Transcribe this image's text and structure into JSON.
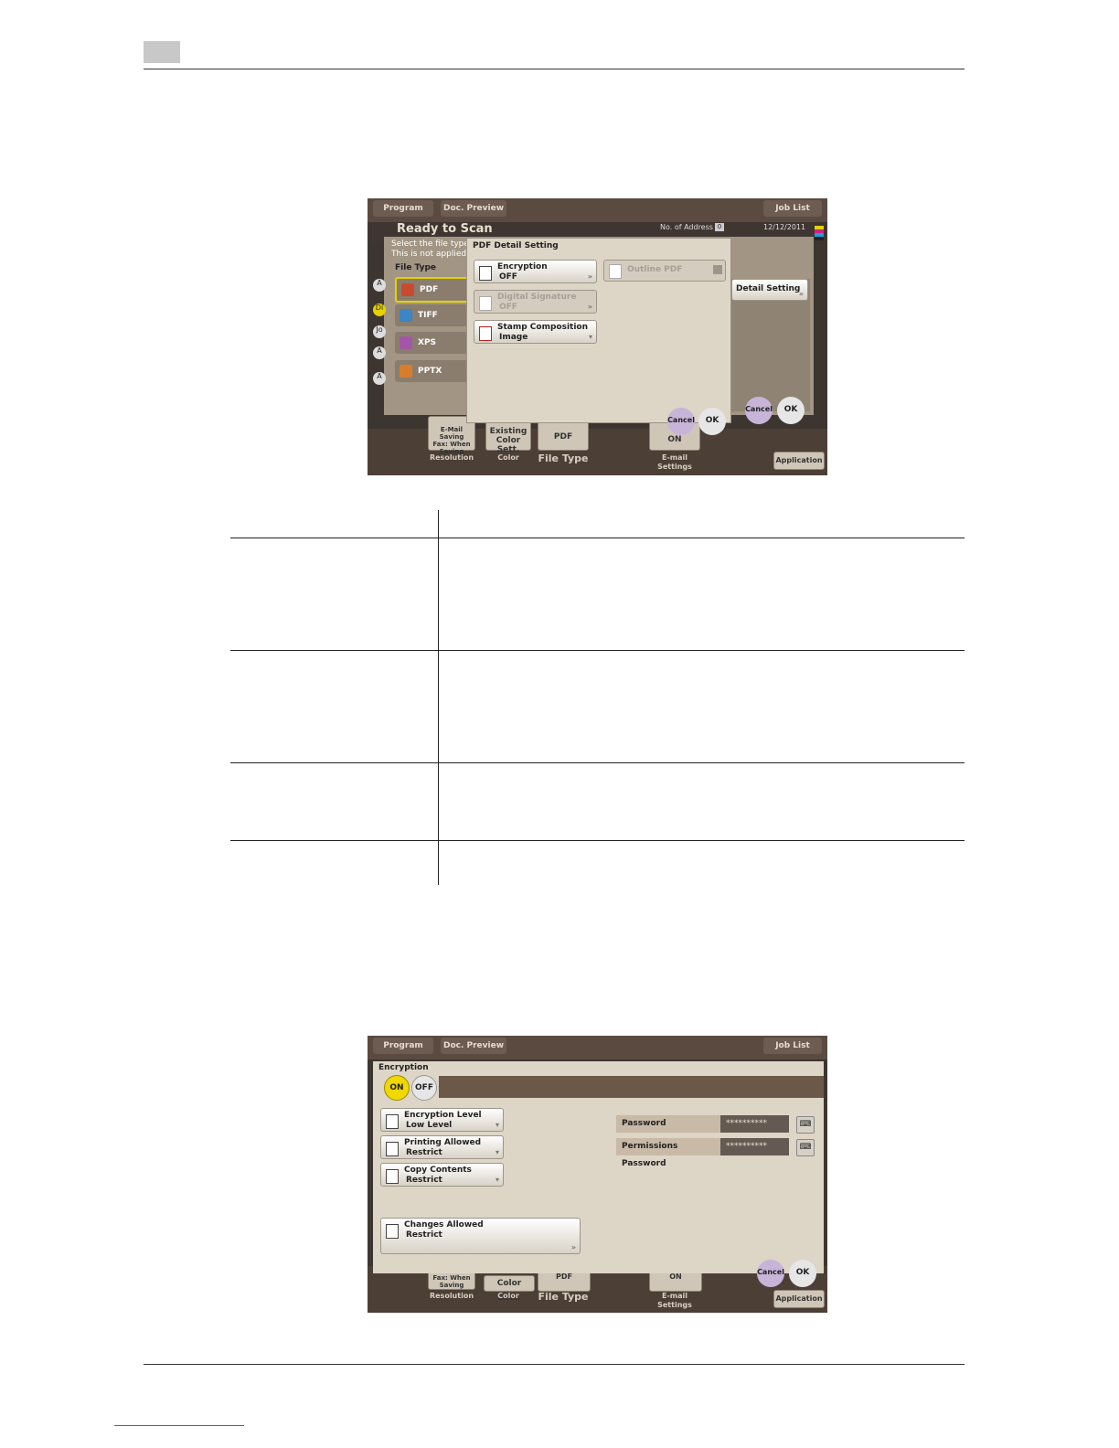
{
  "screen1": {
    "top_buttons": {
      "program": "Program",
      "doc_preview": "Doc. Preview",
      "job_list": "Job List"
    },
    "status": {
      "title": "Ready to Scan",
      "address": "No. of Address",
      "address_count": "0",
      "date": "12/12/2011"
    },
    "instructions": [
      "Select the file type fo",
      "This is not applied to"
    ],
    "file_type_label": "File Type",
    "file_types": [
      "PDF",
      "TIFF",
      "XPS",
      "PPTX"
    ],
    "left_tabs": [
      "A",
      "Di",
      "Jo",
      "A",
      "A"
    ],
    "dialog": {
      "title": "PDF Detail Setting",
      "encryption": {
        "label": "Encryption",
        "value": "OFF"
      },
      "digital_signature": {
        "label": "Digital Signature",
        "value": "OFF"
      },
      "stamp_composition": {
        "label": "Stamp Composition",
        "value": "Image"
      },
      "outline_pdf": "Outline PDF",
      "cancel": "Cancel",
      "ok": "OK"
    },
    "right_panel": {
      "detail_setting": "Detail Setting",
      "cancel": "Cancel",
      "ok": "OK"
    },
    "bottom": {
      "resolution_tile": "E-Mail\nSaving\nFax: When\nSaving",
      "resolution": "Resolution",
      "color_tile": "Existing\nColor Sett.",
      "color": "Color",
      "file_type_tile": "PDF",
      "file_type": "File Type",
      "email_tile": "ON",
      "email": "E-mail\nSettings",
      "application": "Application"
    }
  },
  "screen2": {
    "top_buttons": {
      "program": "Program",
      "doc_preview": "Doc. Preview",
      "job_list": "Job List"
    },
    "title": "Encryption",
    "on": "ON",
    "off": "OFF",
    "encryption_level": {
      "label": "Encryption Level",
      "value": "Low Level"
    },
    "printing_allowed": {
      "label": "Printing Allowed",
      "value": "Restrict"
    },
    "copy_contents": {
      "label": "Copy Contents",
      "value": "Restrict"
    },
    "changes_allowed": {
      "label": "Changes Allowed",
      "value": "Restrict"
    },
    "password": {
      "label": "Password",
      "value": "**********"
    },
    "permissions_password": {
      "label": "Permissions Password",
      "value": "**********"
    },
    "cancel": "Cancel",
    "ok": "OK",
    "bottom": {
      "resolution_tile": "Fax: When\nSaving",
      "resolution": "Resolution",
      "color_tile": "Color Sett.",
      "color": "Color",
      "file_type_tile": "PDF",
      "file_type": "File Type",
      "email_tile": "ON",
      "email": "E-mail\nSettings",
      "application": "Application"
    }
  }
}
